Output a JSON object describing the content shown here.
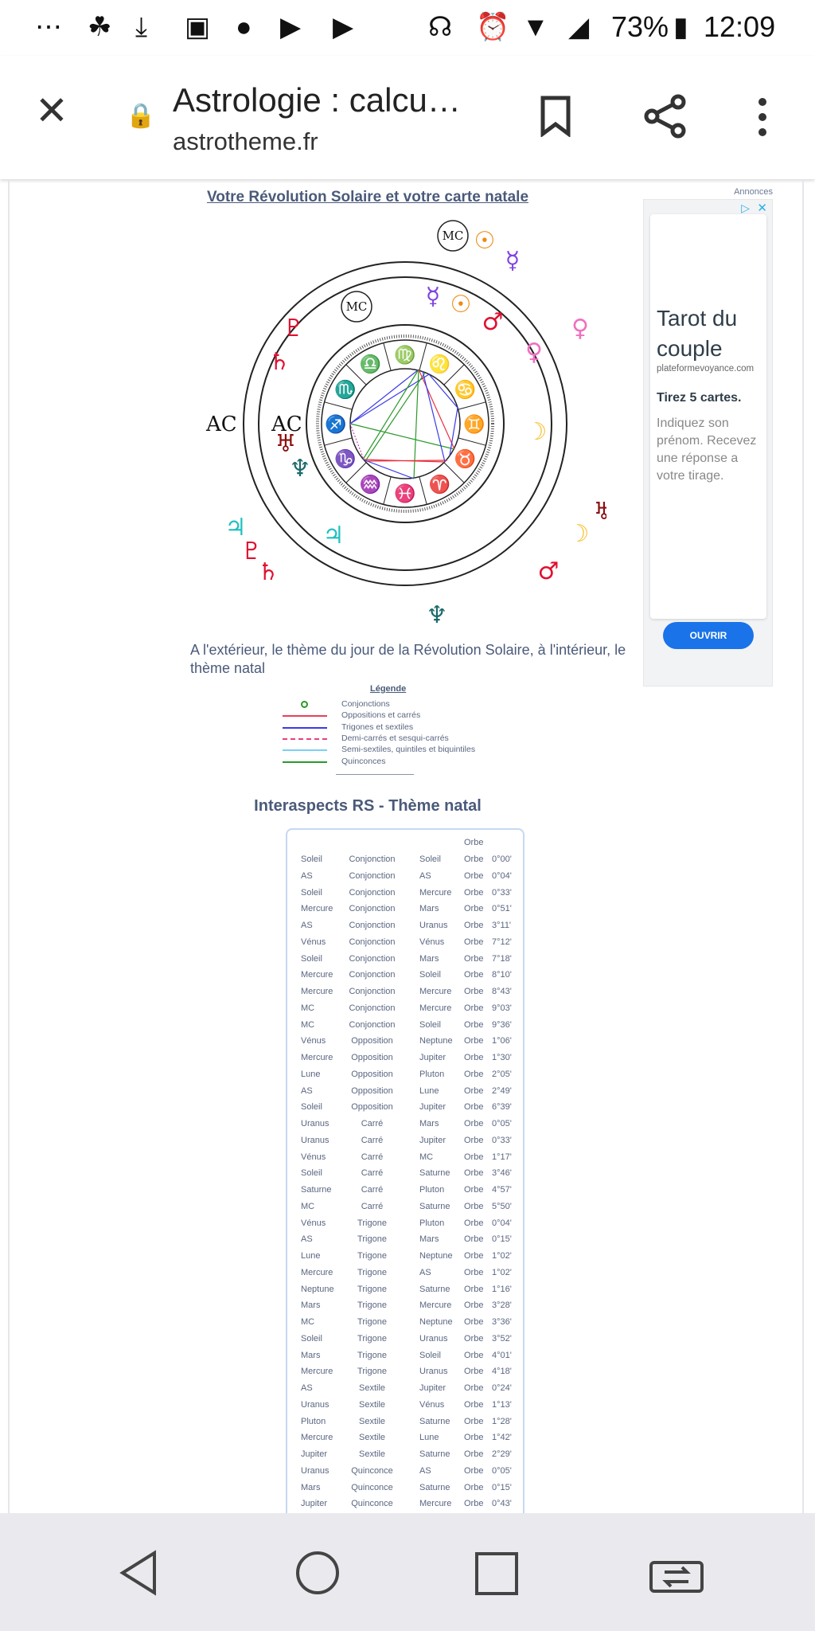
{
  "status_bar": {
    "battery": "73%",
    "time": "12:09",
    "icons": [
      "more-icon",
      "leaf-icon",
      "download-icon",
      "image-icon",
      "messenger-icon",
      "youtube-icon",
      "youtube-icon",
      "headset-icon",
      "alarm-icon",
      "wifi-icon",
      "signal-icon",
      "battery-icon"
    ]
  },
  "browser": {
    "page_title": "Astrologie : calcu…",
    "url": "astrotheme.fr"
  },
  "page": {
    "heading": "Votre Révolution Solaire et votre carte natale",
    "caption": "A l'extérieur, le thème du jour de la Révolution Solaire, à l'intérieur, le thème natal",
    "chart_labels": {
      "ac": "AC",
      "mc": "MC"
    },
    "signs": [
      "♈",
      "♉",
      "♊",
      "♋",
      "♌",
      "♍",
      "♎",
      "♏",
      "♐",
      "♑",
      "♒",
      "♓"
    ],
    "legend": {
      "title": "Légende",
      "items": [
        {
          "label": "Conjonctions",
          "color": "#2a9a2a",
          "style": "circle"
        },
        {
          "label": "Oppositions et carrés",
          "color": "#e8405a",
          "style": "solid"
        },
        {
          "label": "Trigones et sextiles",
          "color": "#3a3ae8",
          "style": "solid"
        },
        {
          "label": "Demi-carrés et sesqui-carrés",
          "color": "#e8407a",
          "style": "dashed"
        },
        {
          "label": "Semi-sextiles, quintiles et biquintiles",
          "color": "#7ad0f0",
          "style": "solid"
        },
        {
          "label": "Quinconces",
          "color": "#2a9a2a",
          "style": "solid"
        }
      ]
    },
    "interaspects": {
      "title": "Interaspects RS - Thème natal",
      "header_orbe": "Orbe",
      "rows": [
        [
          "Soleil",
          "Conjonction",
          "Soleil",
          "Orbe",
          "0°00'"
        ],
        [
          "AS",
          "Conjonction",
          "AS",
          "Orbe",
          "0°04'"
        ],
        [
          "Soleil",
          "Conjonction",
          "Mercure",
          "Orbe",
          "0°33'"
        ],
        [
          "Mercure",
          "Conjonction",
          "Mars",
          "Orbe",
          "0°51'"
        ],
        [
          "AS",
          "Conjonction",
          "Uranus",
          "Orbe",
          "3°11'"
        ],
        [
          "Vénus",
          "Conjonction",
          "Vénus",
          "Orbe",
          "7°12'"
        ],
        [
          "Soleil",
          "Conjonction",
          "Mars",
          "Orbe",
          "7°18'"
        ],
        [
          "Mercure",
          "Conjonction",
          "Soleil",
          "Orbe",
          "8°10'"
        ],
        [
          "Mercure",
          "Conjonction",
          "Mercure",
          "Orbe",
          "8°43'"
        ],
        [
          "MC",
          "Conjonction",
          "Mercure",
          "Orbe",
          "9°03'"
        ],
        [
          "MC",
          "Conjonction",
          "Soleil",
          "Orbe",
          "9°36'"
        ],
        [
          "Vénus",
          "Opposition",
          "Neptune",
          "Orbe",
          "1°06'"
        ],
        [
          "Mercure",
          "Opposition",
          "Jupiter",
          "Orbe",
          "1°30'"
        ],
        [
          "Lune",
          "Opposition",
          "Pluton",
          "Orbe",
          "2°05'"
        ],
        [
          "AS",
          "Opposition",
          "Lune",
          "Orbe",
          "2°49'"
        ],
        [
          "Soleil",
          "Opposition",
          "Jupiter",
          "Orbe",
          "6°39'"
        ],
        [
          "Uranus",
          "Carré",
          "Mars",
          "Orbe",
          "0°05'"
        ],
        [
          "Uranus",
          "Carré",
          "Jupiter",
          "Orbe",
          "0°33'"
        ],
        [
          "Vénus",
          "Carré",
          "MC",
          "Orbe",
          "1°17'"
        ],
        [
          "Soleil",
          "Carré",
          "Saturne",
          "Orbe",
          "3°46'"
        ],
        [
          "Saturne",
          "Carré",
          "Pluton",
          "Orbe",
          "4°57'"
        ],
        [
          "MC",
          "Carré",
          "Saturne",
          "Orbe",
          "5°50'"
        ],
        [
          "Vénus",
          "Trigone",
          "Pluton",
          "Orbe",
          "0°04'"
        ],
        [
          "AS",
          "Trigone",
          "Mars",
          "Orbe",
          "0°15'"
        ],
        [
          "Lune",
          "Trigone",
          "Neptune",
          "Orbe",
          "1°02'"
        ],
        [
          "Mercure",
          "Trigone",
          "AS",
          "Orbe",
          "1°02'"
        ],
        [
          "Neptune",
          "Trigone",
          "Saturne",
          "Orbe",
          "1°16'"
        ],
        [
          "Mars",
          "Trigone",
          "Mercure",
          "Orbe",
          "3°28'"
        ],
        [
          "MC",
          "Trigone",
          "Neptune",
          "Orbe",
          "3°36'"
        ],
        [
          "Soleil",
          "Trigone",
          "Uranus",
          "Orbe",
          "3°52'"
        ],
        [
          "Mars",
          "Trigone",
          "Soleil",
          "Orbe",
          "4°01'"
        ],
        [
          "Mercure",
          "Trigone",
          "Uranus",
          "Orbe",
          "4°18'"
        ],
        [
          "AS",
          "Sextile",
          "Jupiter",
          "Orbe",
          "0°24'"
        ],
        [
          "Uranus",
          "Sextile",
          "Vénus",
          "Orbe",
          "1°13'"
        ],
        [
          "Pluton",
          "Sextile",
          "Saturne",
          "Orbe",
          "1°28'"
        ],
        [
          "Mercure",
          "Sextile",
          "Lune",
          "Orbe",
          "1°42'"
        ],
        [
          "Jupiter",
          "Sextile",
          "Saturne",
          "Orbe",
          "2°29'"
        ],
        [
          "Uranus",
          "Quinconce",
          "AS",
          "Orbe",
          "0°05'"
        ],
        [
          "Mars",
          "Quinconce",
          "Saturne",
          "Orbe",
          "0°15'"
        ],
        [
          "Jupiter",
          "Quinconce",
          "Mercure",
          "Orbe",
          "0°43'"
        ]
      ]
    }
  },
  "ad": {
    "label": "Annonces",
    "headline": "Tarot du couple",
    "domain": "plateformevoyance.com",
    "subhead": "Tirez 5 cartes.",
    "body": "Indiquez son prénom. Recevez une réponse a votre tirage.",
    "cta": "OUVRIR",
    "cta_color": "#1a73e8"
  }
}
